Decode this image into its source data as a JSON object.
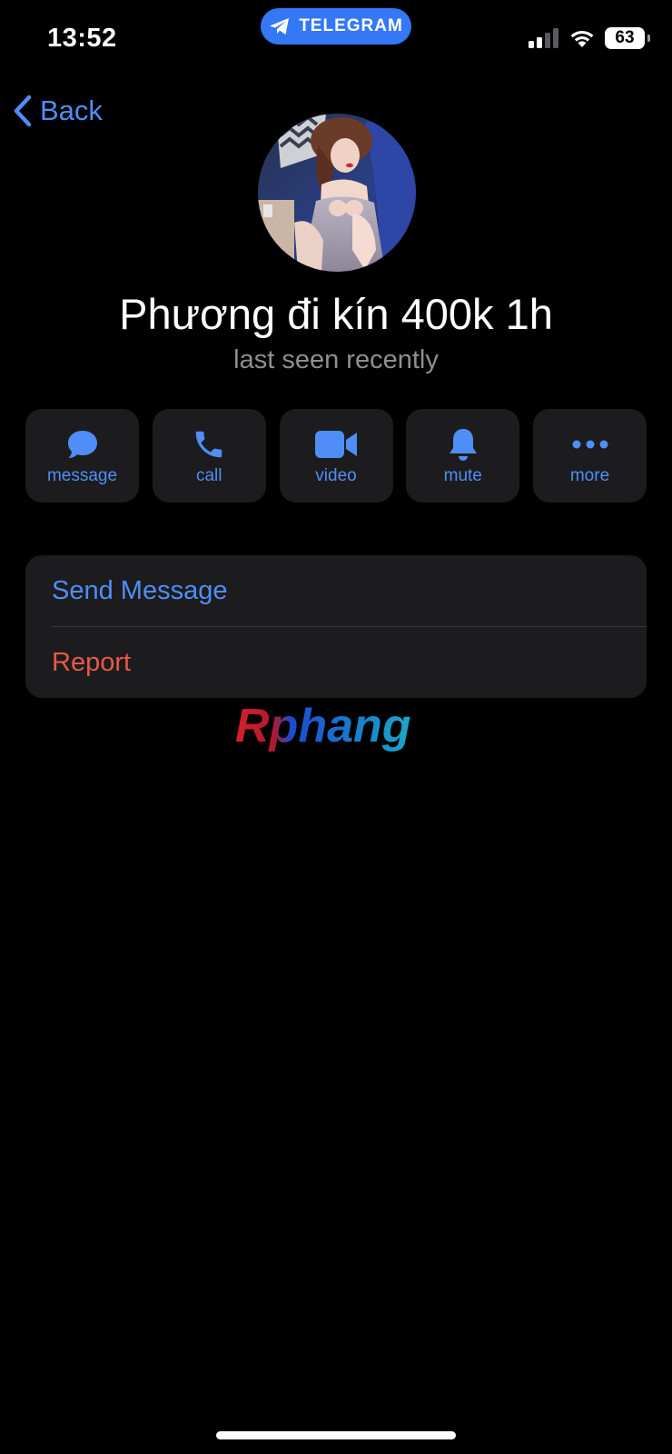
{
  "status_bar": {
    "time": "13:52",
    "app_pill": "TELEGRAM",
    "battery": "63",
    "icons": [
      "cellular-signal-icon",
      "wifi-icon",
      "battery-icon"
    ]
  },
  "nav": {
    "back_label": "Back"
  },
  "profile": {
    "name": "Phương đi kín 400k 1h",
    "status": "last seen recently"
  },
  "actions": [
    {
      "label": "message",
      "icon": "chat-bubble-icon"
    },
    {
      "label": "call",
      "icon": "phone-icon"
    },
    {
      "label": "video",
      "icon": "video-camera-icon"
    },
    {
      "label": "mute",
      "icon": "bell-icon"
    },
    {
      "label": "more",
      "icon": "ellipsis-icon"
    }
  ],
  "list": {
    "send_message": "Send Message",
    "report": "Report"
  },
  "watermark": "Rphang",
  "colors": {
    "accent": "#4f8ef7",
    "danger": "#e8584a",
    "card": "#1c1c1e",
    "pill": "#3478f6"
  }
}
